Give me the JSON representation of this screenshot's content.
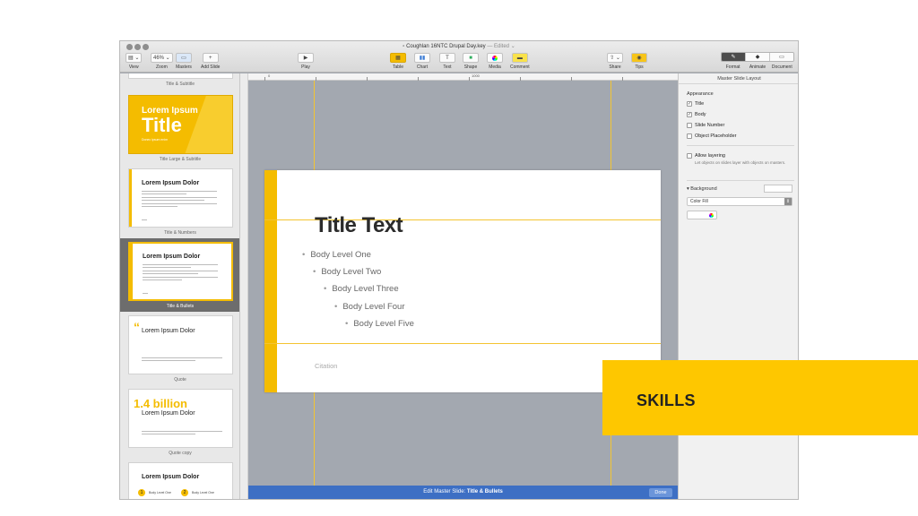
{
  "window": {
    "file_name": "Coughlan 16NTC Drupal Day.key",
    "edited_label": "— Edited ⌄"
  },
  "toolbar": {
    "view": "View",
    "zoom": "Zoom",
    "zoom_value": "46%",
    "masters": "Masters",
    "add_slide": "Add Slide",
    "play": "Play",
    "table": "Table",
    "chart": "Chart",
    "text": "Text",
    "shape": "Shape",
    "media": "Media",
    "comment": "Comment",
    "share": "Share",
    "tips": "Tips",
    "format": "Format",
    "animate": "Animate",
    "document": "Document"
  },
  "navigator": {
    "masters": [
      {
        "caption": "Title & Subtitle"
      },
      {
        "caption": "Title Large & Subtitle",
        "title_line1": "Lorem Ipsum",
        "title_line2": "Title",
        "subtitle": "Donec ipsum enim"
      },
      {
        "caption": "Title & Numbers",
        "title": "Lorem Ipsum Dolor"
      },
      {
        "caption": "Title & Bullets",
        "title": "Lorem Ipsum Dolor",
        "selected": true
      },
      {
        "caption": "Quote",
        "title": "Lorem Ipsum Dolor"
      },
      {
        "caption": "Quote copy",
        "big": "1.4 billion",
        "title": "Lorem Ipsum Dolor"
      },
      {
        "title": "Lorem Ipsum Dolor",
        "item1": "Body Level One",
        "item2": "Body Level One"
      }
    ]
  },
  "ruler": {
    "zero": "0",
    "mark": "1000"
  },
  "slide": {
    "title": "Title Text",
    "bullets": [
      "Body Level One",
      "Body Level Two",
      "Body Level Three",
      "Body Level Four",
      "Body Level Five"
    ],
    "citation": "Citation"
  },
  "edit_bar": {
    "prefix": "Edit Master Slide: ",
    "master_name": "Title & Bullets",
    "done": "Done"
  },
  "inspector": {
    "header": "Master Slide Layout",
    "appearance": "Appearance",
    "checks": [
      {
        "label": "Title",
        "checked": true
      },
      {
        "label": "Body",
        "checked": true
      },
      {
        "label": "Slide Number",
        "checked": false
      },
      {
        "label": "Object Placeholder",
        "checked": false
      }
    ],
    "allow_layering": "Allow layering",
    "allow_layering_note": "Let objects on slides layer with objects on masters.",
    "background": "Background",
    "fill_type": "Color Fill"
  },
  "overlay": {
    "label": "SKILLS"
  },
  "colors": {
    "accent": "#f4bc00",
    "banner": "#fec700",
    "edit_bar": "#3d6fc4"
  }
}
